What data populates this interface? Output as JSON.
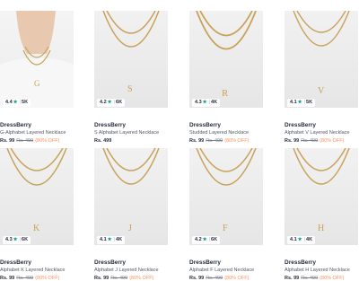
{
  "colors": {
    "rating_star": "#14958f",
    "discount": "#ff905a",
    "gold": "#c9a25a"
  },
  "products": [
    {
      "image_style": "model",
      "rating": "4.4",
      "star_icon": "star-icon",
      "count": "5K",
      "brand": "DressBerry",
      "name": "G-Alphabet Layered Necklace",
      "price": "Rs. 99",
      "mrp": "Rs. 499",
      "discount": "(80% OFF)"
    },
    {
      "image_style": "flat",
      "rating": "4.2",
      "star_icon": "star-icon",
      "count": "6K",
      "brand": "DressBerry",
      "name": "S Alphabet Layered Necklace",
      "price": "Rs. 499",
      "mrp": "",
      "discount": ""
    },
    {
      "image_style": "flat",
      "rating": "4.3",
      "star_icon": "star-icon",
      "count": "4K",
      "brand": "DressBerry",
      "name": "Studded Layered Necklace",
      "price": "Rs. 99",
      "mrp": "Rs. 499",
      "discount": "(80% OFF)"
    },
    {
      "image_style": "flat",
      "rating": "4.1",
      "star_icon": "star-icon",
      "count": "5K",
      "brand": "DressBerry",
      "name": "Alphabet V Layered Necklace",
      "price": "Rs. 99",
      "mrp": "Rs. 499",
      "discount": "(80% OFF)"
    },
    {
      "image_style": "flat",
      "rating": "4.3",
      "star_icon": "star-icon",
      "count": "6K",
      "brand": "DressBerry",
      "name": "Alphabet K Layered Necklace",
      "price": "Rs. 99",
      "mrp": "Rs. 499",
      "discount": "(80% OFF)"
    },
    {
      "image_style": "flat",
      "rating": "4.1",
      "star_icon": "star-icon",
      "count": "4K",
      "brand": "DressBerry",
      "name": "Alphabet J Layered Necklace",
      "price": "Rs. 99",
      "mrp": "Rs. 499",
      "discount": "(80% OFF)"
    },
    {
      "image_style": "flat",
      "rating": "4.2",
      "star_icon": "star-icon",
      "count": "6K",
      "brand": "DressBerry",
      "name": "Alphabet F Layered Necklace",
      "price": "Rs. 99",
      "mrp": "Rs. 499",
      "discount": "(80% OFF)"
    },
    {
      "image_style": "flat",
      "rating": "4.1",
      "star_icon": "star-icon",
      "count": "4K",
      "brand": "DressBerry",
      "name": "Alphabet H Layered Necklace",
      "price": "Rs. 99",
      "mrp": "Rs. 499",
      "discount": "(80% OFF)"
    }
  ]
}
